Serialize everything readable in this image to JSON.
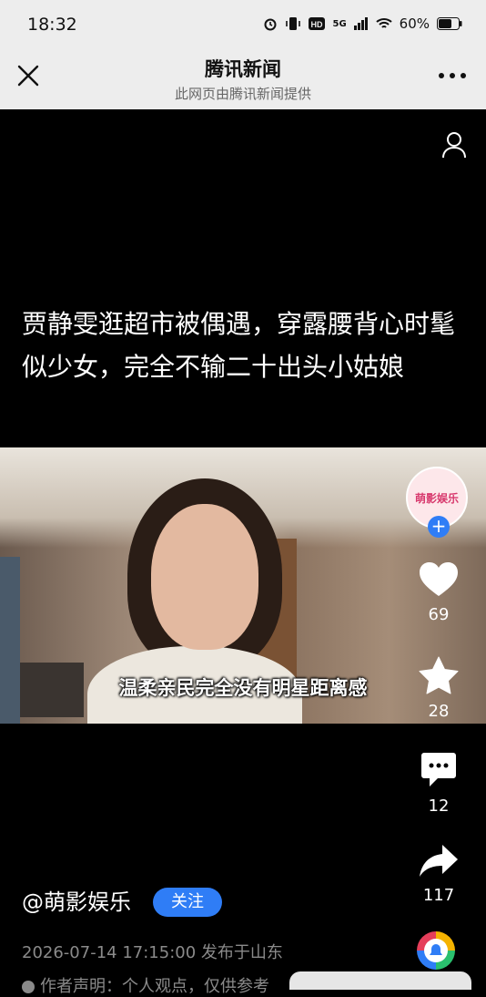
{
  "status_bar": {
    "time": "18:32",
    "network": "5G",
    "battery": "60%",
    "icons": [
      "alarm-icon",
      "vibrate-icon",
      "hd-icon",
      "signal-icon",
      "wifi-icon",
      "battery-icon"
    ]
  },
  "header": {
    "title": "腾讯新闻",
    "subtitle": "此网页由腾讯新闻提供",
    "close_icon": "close-icon",
    "more_icon": "more-icon"
  },
  "post": {
    "headline": "贾静雯逛超市被偶遇，穿露腰背心时髦似少女，完全不输二十出头小姑娘",
    "video_caption": "温柔亲民完全没有明星距离感",
    "author": "@萌影娱乐",
    "follow_label": "关注",
    "avatar_text": "萌影娱乐",
    "meta": "2026-07-14 17:15:00 发布于山东",
    "declaration": "作者声明：个人观点，仅供参考"
  },
  "actions": {
    "likes": "69",
    "favorites": "28",
    "comments": "12",
    "shares": "117"
  },
  "colors": {
    "accent": "#2f7df6",
    "header_bg": "#ededed",
    "content_bg": "#000000"
  }
}
